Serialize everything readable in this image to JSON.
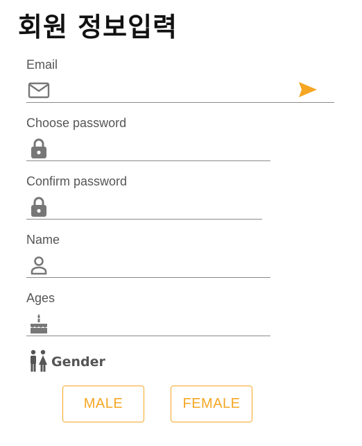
{
  "header": {
    "title": "회원 정보입력"
  },
  "form": {
    "email": {
      "label": "Email",
      "icon": "mail-icon",
      "value": "",
      "placeholder": "",
      "action_icon": "send-icon"
    },
    "password": {
      "label": "Choose password",
      "icon": "lock-icon",
      "value": "",
      "placeholder": ""
    },
    "confirm_password": {
      "label": "Confirm password",
      "icon": "lock-icon",
      "value": "",
      "placeholder": ""
    },
    "name": {
      "label": "Name",
      "icon": "person-icon",
      "value": "",
      "placeholder": ""
    },
    "age": {
      "label": "Ages",
      "icon": "cake-icon",
      "value": "",
      "placeholder": ""
    },
    "gender": {
      "label": "Gender",
      "icon": "gender-icon",
      "options": [
        "MALE",
        "FEMALE"
      ]
    }
  },
  "colors": {
    "accent": "#F5A623",
    "icon": "#777777",
    "underline": "#8A8A8A",
    "label": "#555555",
    "title": "#111111"
  }
}
